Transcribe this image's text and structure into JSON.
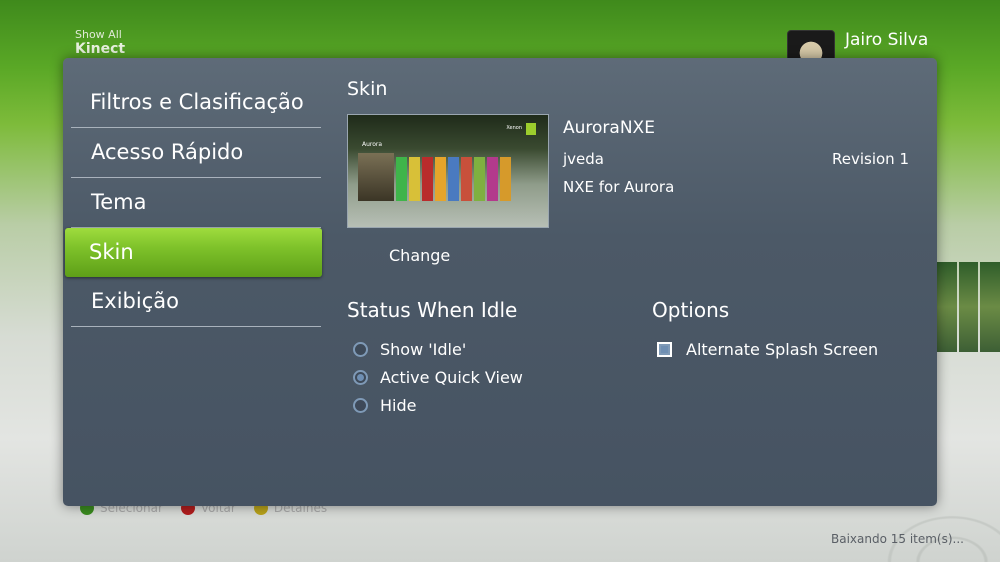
{
  "background": {
    "top_left_small": "Show All",
    "top_left_large": "Kinect",
    "gamertag": "Jairo Silva",
    "bottom_buttons": [
      {
        "icon": "a-button-icon",
        "label": "Selecionar"
      },
      {
        "icon": "b-button-icon",
        "label": "Voltar"
      },
      {
        "icon": "y-button-icon",
        "label": "Detalhes"
      }
    ],
    "download_status": "Baixando 15 item(s)..."
  },
  "menu": {
    "items": [
      {
        "label": "Filtros e Clasificação",
        "selected": false
      },
      {
        "label": "Acesso Rápido",
        "selected": false
      },
      {
        "label": "Tema",
        "selected": false
      },
      {
        "label": "Skin",
        "selected": true
      },
      {
        "label": "Exibição",
        "selected": false
      }
    ]
  },
  "skin": {
    "title": "Skin",
    "preview_brand": "Aurora",
    "preview_logo_label": "Xenon",
    "change_label": "Change",
    "name": "AuroraNXE",
    "author": "jveda",
    "revision": "Revision 1",
    "description": "NXE for Aurora"
  },
  "status_when_idle": {
    "title": "Status When Idle",
    "options": [
      {
        "label": "Show 'Idle'",
        "checked": false
      },
      {
        "label": "Active Quick View",
        "checked": true
      },
      {
        "label": "Hide",
        "checked": false
      }
    ]
  },
  "options": {
    "title": "Options",
    "alternate_splash": {
      "label": "Alternate Splash Screen",
      "checked": true
    }
  },
  "colors": {
    "dialog_bg": "#4c5967",
    "selected_green": "#7ec22a",
    "radio_blue": "#6f8fb3"
  }
}
